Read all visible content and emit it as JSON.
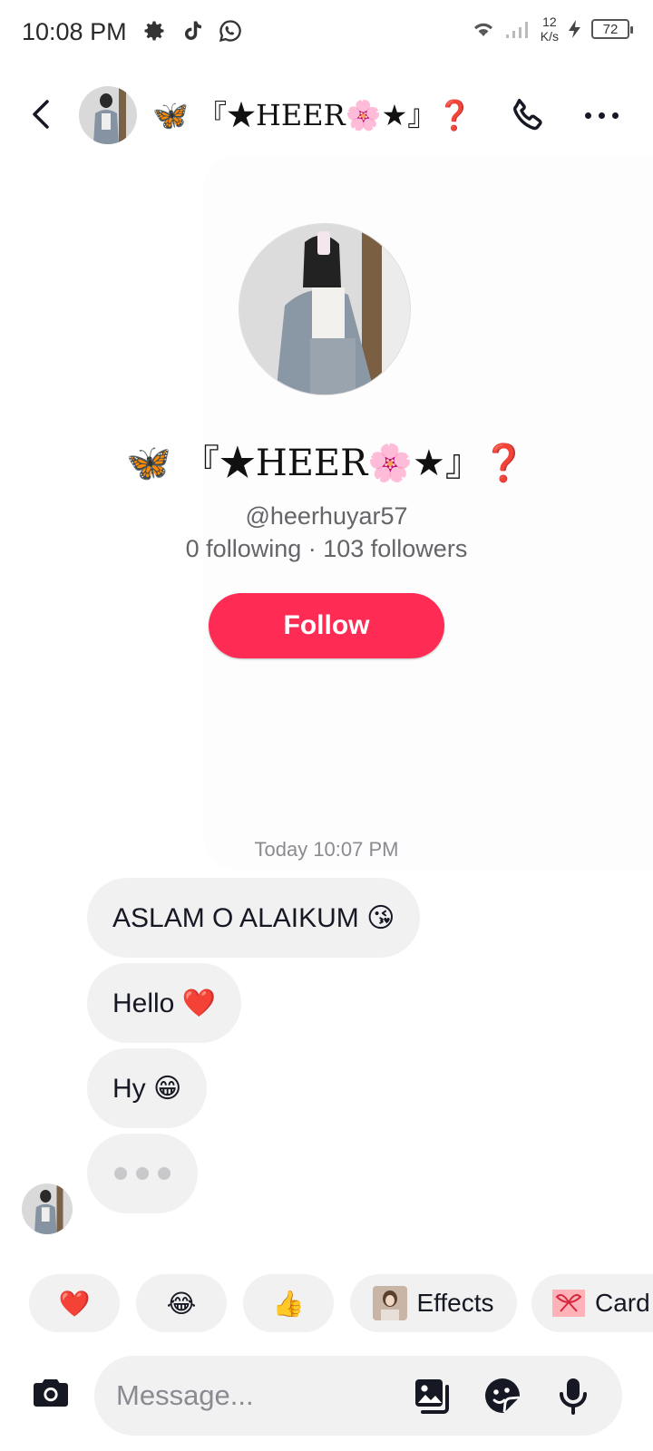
{
  "status_bar": {
    "time": "10:08 PM",
    "speed_value": "12",
    "speed_unit": "K/s",
    "battery": "72"
  },
  "header": {
    "name": "🦋 『★HEER🌸★』❓"
  },
  "profile": {
    "name": "🦋 『★HEER🌸★』❓",
    "handle": "@heerhuyar57",
    "stats": "0 following · 103 followers",
    "follow_label": "Follow"
  },
  "conversation": {
    "timestamp": "Today 10:07 PM",
    "messages": [
      {
        "text": "ASLAM O ALAIKUM 😘"
      },
      {
        "text": "Hello ❤️"
      },
      {
        "text": "Hy 😁"
      }
    ]
  },
  "quick_replies": [
    {
      "emoji": "❤️"
    },
    {
      "emoji": "😂"
    },
    {
      "emoji": "👍"
    },
    {
      "label": "Effects"
    },
    {
      "label": "Card"
    }
  ],
  "composer": {
    "placeholder": "Message..."
  },
  "colors": {
    "follow": "#fe2c55",
    "bubble": "#f1f1f2",
    "muted_text": "#646469"
  }
}
